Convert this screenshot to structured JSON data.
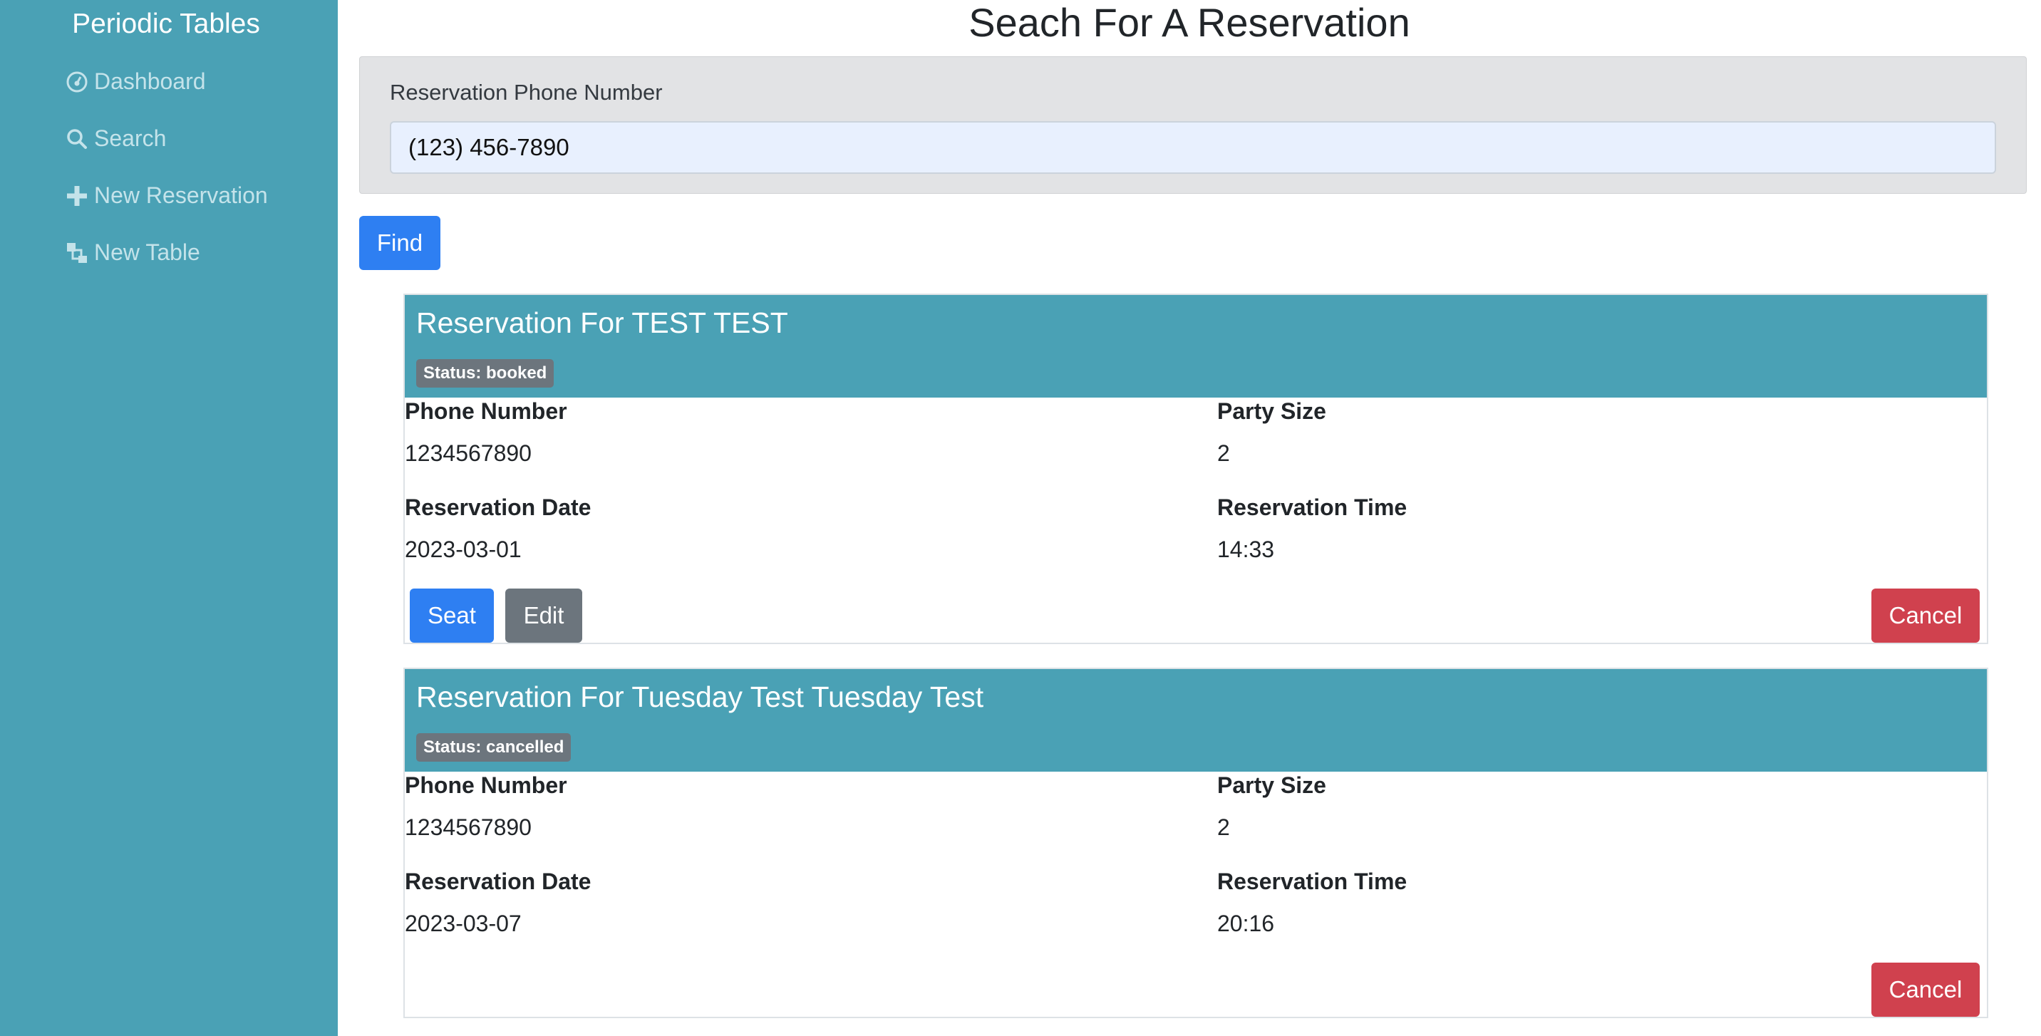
{
  "sidebar": {
    "brand": "Periodic Tables",
    "items": [
      {
        "label": "Dashboard",
        "icon": "dashboard-icon"
      },
      {
        "label": "Search",
        "icon": "search-icon"
      },
      {
        "label": "New Reservation",
        "icon": "plus-icon"
      },
      {
        "label": "New Table",
        "icon": "table-icon"
      }
    ]
  },
  "page": {
    "title": "Seach For A Reservation"
  },
  "search": {
    "label": "Reservation Phone Number",
    "value": "(123) 456-7890",
    "find_label": "Find"
  },
  "reservations": [
    {
      "title": "Reservation For TEST TEST",
      "status": "Status: booked",
      "phone_label": "Phone Number",
      "phone": "1234567890",
      "party_label": "Party Size",
      "party": "2",
      "date_label": "Reservation Date",
      "date": "2023-03-01",
      "time_label": "Reservation Time",
      "time": "14:33",
      "seat_label": "Seat",
      "edit_label": "Edit",
      "cancel_label": "Cancel"
    },
    {
      "title": "Reservation For Tuesday Test Tuesday Test",
      "status": "Status: cancelled",
      "phone_label": "Phone Number",
      "phone": "1234567890",
      "party_label": "Party Size",
      "party": "2",
      "date_label": "Reservation Date",
      "date": "2023-03-07",
      "time_label": "Reservation Time",
      "time": "20:16",
      "cancel_label": "Cancel"
    }
  ],
  "colors": {
    "sidebar": "#4aa1b5",
    "primary": "#2e7ff2",
    "secondary": "#6c757d",
    "danger": "#d0414e"
  }
}
